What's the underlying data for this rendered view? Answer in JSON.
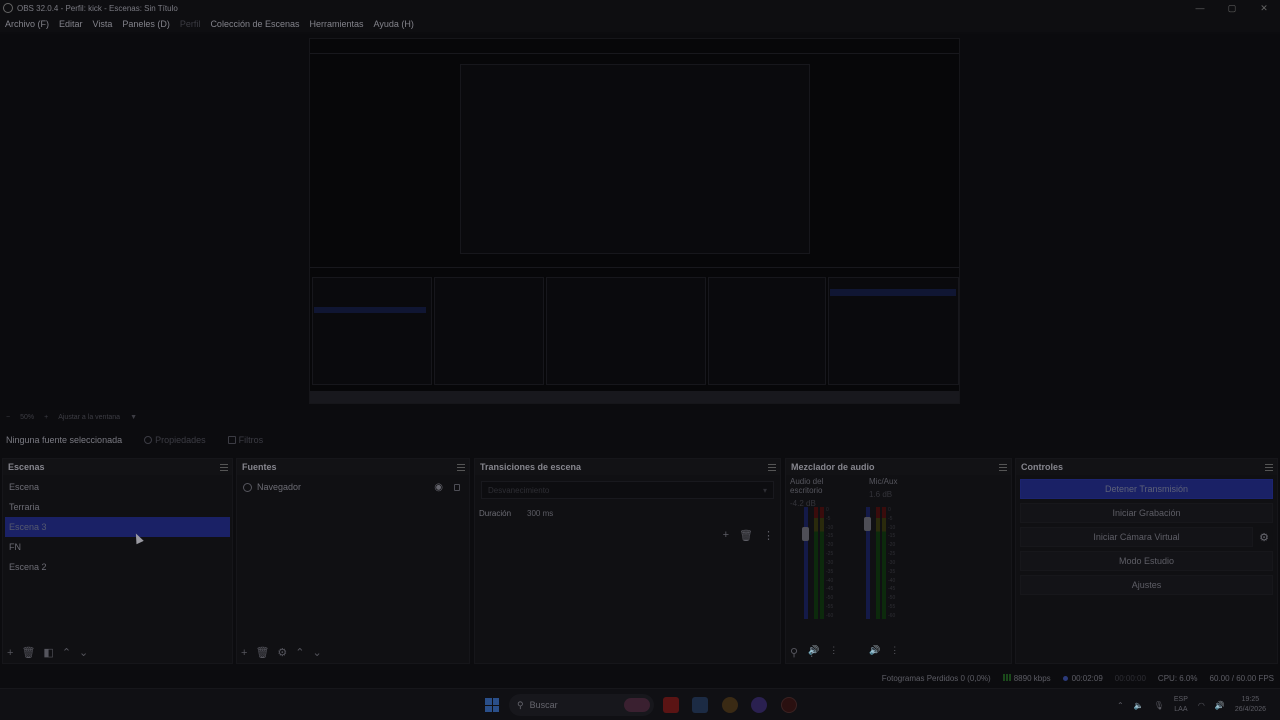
{
  "window": {
    "title": "OBS 32.0.4 - Perfil: kick - Escenas: Sin Título"
  },
  "menu": [
    {
      "label": "Archivo (F)",
      "enabled": true
    },
    {
      "label": "Editar",
      "enabled": true
    },
    {
      "label": "Vista",
      "enabled": true
    },
    {
      "label": "Paneles (D)",
      "enabled": true
    },
    {
      "label": "Perfil",
      "enabled": false
    },
    {
      "label": "Colección de Escenas",
      "enabled": true
    },
    {
      "label": "Herramientas",
      "enabled": true
    },
    {
      "label": "Ayuda (H)",
      "enabled": true
    }
  ],
  "zoom": {
    "value": "50%",
    "fit_label": "Ajustar a la ventana"
  },
  "context": {
    "no_source": "Ninguna fuente seleccionada",
    "properties": "Propiedades",
    "filters": "Filtros"
  },
  "scenes": {
    "title": "Escenas",
    "items": [
      "Escena",
      "Terraria",
      "Escena 3",
      "FN",
      "Escena 2"
    ],
    "selected": "Escena 3"
  },
  "sources": {
    "title": "Fuentes",
    "items": [
      {
        "label": "Navegador",
        "icon": "globe-icon"
      }
    ]
  },
  "transitions": {
    "title": "Transiciones de escena",
    "selected": "Desvanecimiento",
    "duration_label": "Duración",
    "duration_value": "300 ms"
  },
  "mixer": {
    "title": "Mezclador de audio",
    "channels": [
      {
        "name": "Audio del escritorio",
        "db": "-4.2 dB"
      },
      {
        "name": "Mic/Aux",
        "db": "1.6 dB"
      }
    ],
    "scale": [
      "0",
      "-5",
      "-10",
      "-15",
      "-20",
      "-25",
      "-30",
      "-35",
      "-40",
      "-45",
      "-50",
      "-55",
      "-60"
    ]
  },
  "controls": {
    "title": "Controles",
    "buttons": [
      "Detener Transmisión",
      "Iniciar Grabación",
      "Iniciar Cámara Virtual",
      "Modo Estudio",
      "Ajustes"
    ]
  },
  "status": {
    "dropped": "Fotogramas Perdidos 0 (0,0%)",
    "bitrate": "8890 kbps",
    "stream_time": "00:02:09",
    "rec_time": "00:00:00",
    "cpu": "CPU: 6.0%",
    "fps": "60.00 / 60.00 FPS"
  },
  "taskbar": {
    "search": "Buscar",
    "lang_top": "ESP",
    "lang_bottom": "LAA",
    "time": "19:25",
    "date": "26/4/2026"
  }
}
